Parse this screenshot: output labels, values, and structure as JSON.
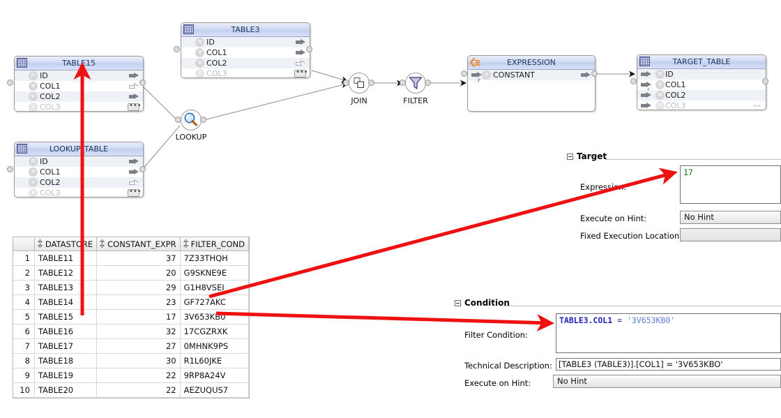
{
  "diagram": {
    "tables": [
      {
        "id": "table15",
        "title": "TABLE15",
        "icon": "grid-table-icon",
        "columns": [
          {
            "name": "ID",
            "type_badge": "n",
            "port": "filled"
          },
          {
            "name": "COL1",
            "type_badge": "v",
            "port": "hollow"
          },
          {
            "name": "COL2",
            "type_badge": "v",
            "port": "filled"
          },
          {
            "name": "COL3",
            "type_badge": "v",
            "port": "more"
          }
        ]
      },
      {
        "id": "lookup_table",
        "title": "LOOKUP_TABLE",
        "icon": "grid-table-icon",
        "columns": [
          {
            "name": "ID",
            "type_badge": "n",
            "port": "filled"
          },
          {
            "name": "COL1",
            "type_badge": "v",
            "port": "filled"
          },
          {
            "name": "COL2",
            "type_badge": "v",
            "port": "hollow"
          },
          {
            "name": "COL3",
            "type_badge": "v",
            "port": "more"
          }
        ]
      },
      {
        "id": "table3",
        "title": "TABLE3",
        "icon": "grid-table-icon",
        "columns": [
          {
            "name": "ID",
            "type_badge": "n",
            "port": "filled"
          },
          {
            "name": "COL1",
            "type_badge": "v",
            "port": "filled"
          },
          {
            "name": "COL2",
            "type_badge": "v",
            "port": "hollow"
          },
          {
            "name": "COL3",
            "type_badge": "v",
            "port": "more"
          }
        ]
      },
      {
        "id": "target_table",
        "title": "TARGET_TABLE",
        "icon": "grid-table-icon",
        "columns": [
          {
            "name": "ID",
            "type_badge": "n",
            "port": "filled"
          },
          {
            "name": "COL1",
            "type_badge": "v",
            "port": "filled-f"
          },
          {
            "name": "COL2",
            "type_badge": "v",
            "port": "filled"
          },
          {
            "name": "COL3",
            "type_badge": "v",
            "port": "more"
          }
        ]
      }
    ],
    "expression_node": {
      "title": "EXPRESSION",
      "icon": "expression-orange-icon",
      "columns": [
        {
          "name": "CONSTANT",
          "type_badge": "v"
        }
      ]
    },
    "operators": [
      {
        "id": "lookup",
        "label": "LOOKUP",
        "icon": "magnifier-icon"
      },
      {
        "id": "join",
        "label": "JOIN",
        "icon": "join-squares-icon"
      },
      {
        "id": "filter",
        "label": "FILTER",
        "icon": "funnel-icon"
      }
    ]
  },
  "data_grid": {
    "columns": [
      "DATASTORE",
      "CONSTANT_EXPR",
      "FILTER_COND"
    ],
    "rows": [
      {
        "n": "1",
        "DATASTORE": "TABLE11",
        "CONSTANT_EXPR": "37",
        "FILTER_COND": "7Z33THQH"
      },
      {
        "n": "2",
        "DATASTORE": "TABLE12",
        "CONSTANT_EXPR": "20",
        "FILTER_COND": "G9SKNE9E"
      },
      {
        "n": "3",
        "DATASTORE": "TABLE13",
        "CONSTANT_EXPR": "29",
        "FILTER_COND": "G1H8VSEI"
      },
      {
        "n": "4",
        "DATASTORE": "TABLE14",
        "CONSTANT_EXPR": "23",
        "FILTER_COND": "GF727AKC"
      },
      {
        "n": "5",
        "DATASTORE": "TABLE15",
        "CONSTANT_EXPR": "17",
        "FILTER_COND": "3V653KB0"
      },
      {
        "n": "6",
        "DATASTORE": "TABLE16",
        "CONSTANT_EXPR": "32",
        "FILTER_COND": "17CGZRXK"
      },
      {
        "n": "7",
        "DATASTORE": "TABLE17",
        "CONSTANT_EXPR": "27",
        "FILTER_COND": "0MHNK9PS"
      },
      {
        "n": "8",
        "DATASTORE": "TABLE18",
        "CONSTANT_EXPR": "30",
        "FILTER_COND": "R1L60JKE"
      },
      {
        "n": "9",
        "DATASTORE": "TABLE19",
        "CONSTANT_EXPR": "22",
        "FILTER_COND": "9RP8A24V"
      },
      {
        "n": "10",
        "DATASTORE": "TABLE20",
        "CONSTANT_EXPR": "22",
        "FILTER_COND": "AEZUQUS7"
      }
    ]
  },
  "target_panel": {
    "section_title": "Target",
    "expression_label": "Expression:",
    "expression_value": "17",
    "execute_hint_label": "Execute on Hint:",
    "execute_hint_value": "No Hint",
    "fixed_location_label": "Fixed Execution Location:",
    "fixed_location_value": ""
  },
  "condition_panel": {
    "section_title": "Condition",
    "filter_condition_label": "Filter Condition:",
    "filter_condition_keyword": "TABLE3.COL1",
    "filter_condition_operator": "=",
    "filter_condition_literal": "'3V653KB0'",
    "technical_description_label": "Technical Description:",
    "technical_description_value": "[TABLE3 (TABLE3)].[COL1] = '3V653KBO'",
    "execute_hint_label": "Execute on Hint:",
    "execute_hint_value": "No Hint"
  },
  "annotations": {
    "accent_color": "#ee1111",
    "arrow_table15_to_node": "vertical-arrow-to-table15",
    "arrow_constant_to_expression": "arrow-row5-constant-to-expression-field",
    "arrow_filtercond_to_condition": "arrow-row5-filtercond-to-filter-condition-field"
  }
}
